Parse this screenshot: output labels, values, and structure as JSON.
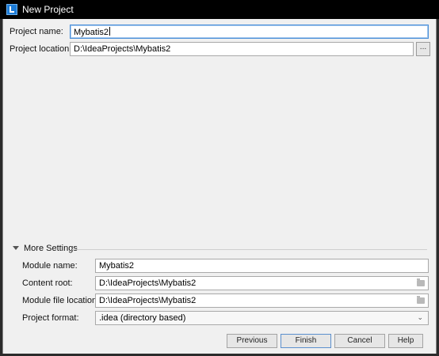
{
  "window": {
    "title": "New Project"
  },
  "project": {
    "name_label": "Project name:",
    "name_value": "Mybatis2",
    "location_label": "Project location:",
    "location_value": "D:\\IdeaProjects\\Mybatis2",
    "browse_label": "..."
  },
  "more_settings": {
    "header": "More Settings",
    "module_name_label": "Module name:",
    "module_name_value": "Mybatis2",
    "content_root_label": "Content root:",
    "content_root_value": "D:\\IdeaProjects\\Mybatis2",
    "module_file_location_label": "Module file location:",
    "module_file_location_value": "D:\\IdeaProjects\\Mybatis2",
    "project_format_label": "Project format:",
    "project_format_value": ".idea (directory based)"
  },
  "buttons": {
    "previous": "Previous",
    "finish": "Finish",
    "cancel": "Cancel",
    "help": "Help"
  },
  "icons": {
    "app": "intellij-idea-icon",
    "browse": "browse-icon",
    "folder": "folder-icon",
    "collapse": "collapse-triangle-icon",
    "dropdown": "chevron-down-icon"
  }
}
